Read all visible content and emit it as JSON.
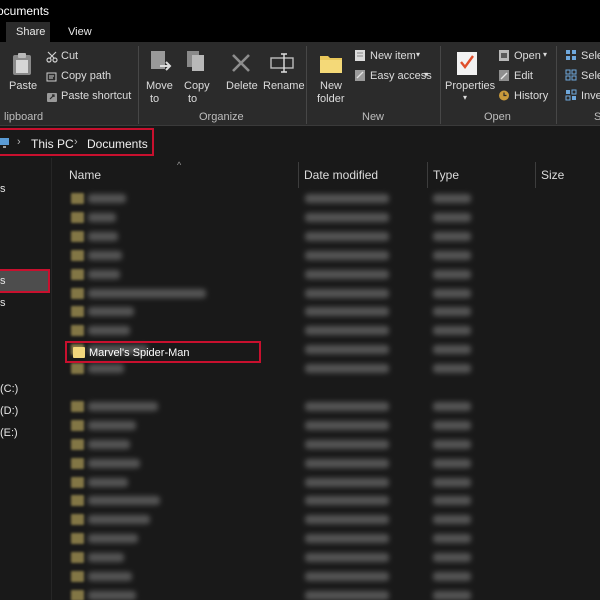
{
  "window": {
    "title": "ocuments"
  },
  "ribbon_tabs": [
    {
      "label": "Share"
    },
    {
      "label": "View"
    }
  ],
  "ribbon": {
    "paste": "Paste",
    "cut": "Cut",
    "copy_path": "Copy path",
    "paste_shortcut": "Paste shortcut",
    "clipboard_group": "lipboard",
    "move_to_1": "Move",
    "move_to_2": "to",
    "copy_to_1": "Copy",
    "copy_to_2": "to",
    "delete": "Delete",
    "rename": "Rename",
    "organize_group": "Organize",
    "new_folder_1": "New",
    "new_folder_2": "folder",
    "new_item": "New item",
    "easy_access": "Easy access",
    "new_group": "New",
    "properties": "Properties",
    "open": "Open",
    "edit": "Edit",
    "history": "History",
    "open_group": "Open",
    "select_1": "Sele",
    "select_2": "Sele",
    "select_3": "Inve",
    "select_group": "S"
  },
  "address": {
    "crumbs": [
      "This PC",
      "Documents"
    ]
  },
  "nav": {
    "items": [
      {
        "label": "s"
      },
      {
        "label": "s"
      },
      {
        "label": "s"
      },
      {
        "label": "(C:)"
      },
      {
        "label": "(D:)"
      },
      {
        "label": "(E:)"
      }
    ]
  },
  "columns": [
    {
      "label": "Name"
    },
    {
      "label": "Date modified"
    },
    {
      "label": "Type"
    },
    {
      "label": "Size"
    }
  ],
  "selected_folder": {
    "name": "Marvel's Spider-Man"
  },
  "colors": {
    "highlight": "#c8102e",
    "folder": "#f2d77c",
    "background": "#191919"
  },
  "icons": [
    "paste-icon",
    "cut-icon",
    "copy-path-icon",
    "paste-shortcut-icon",
    "move-to-icon",
    "copy-to-icon",
    "delete-icon",
    "rename-icon",
    "new-folder-icon",
    "new-item-icon",
    "easy-access-icon",
    "properties-icon",
    "open-icon",
    "edit-icon",
    "history-icon",
    "select-all-icon",
    "folder-icon",
    "pc-icon"
  ]
}
